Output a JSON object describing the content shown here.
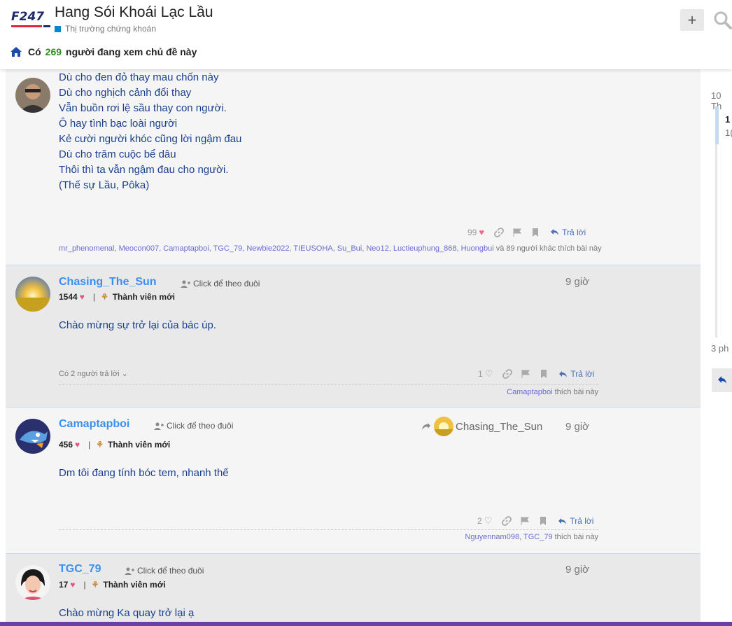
{
  "header": {
    "logo_text": "F247",
    "title": "Hang Sói Khoái Lạc Lầu",
    "category": "Thị trường chứng khoán",
    "plus_label": "+",
    "viewers_prefix": "Có",
    "viewers_count": "269",
    "viewers_suffix": "người đang xem chủ đề này"
  },
  "posts": [
    {
      "body": "Dù cho đen đỏ thay mau chốn này\nDù cho nghịch cảnh đổi thay\nVẫn buồn rơi lệ sầu thay con người.\nÔ hay tình bạc loài người\nKẻ cười người khóc cũng lời ngậm đau\nDù cho trăm cuộc bể dâu\nThôi thì ta vẫn ngậm đau cho người.\n(Thế sự Lầu, Pôka)",
      "like_count": "99",
      "reply_label": "Trả lời",
      "likers": [
        "mr_phenomenal",
        "Meocon007",
        "Camaptapboi",
        "TGC_79",
        "Newbie2022",
        "TIEUSOHA",
        "Su_Bui",
        "Neo12",
        "Luctieuphung_868",
        "Huongbui"
      ],
      "likers_suffix": "và 89 người khác thích bài này"
    },
    {
      "username": "Chasing_The_Sun",
      "follow": "Click để theo đuôi",
      "time": "9 giờ",
      "hearts": "1544",
      "rank": "Thành viên mới",
      "body": "Chào mừng sự trở lại của bác úp.",
      "replies_toggle": "Có 2 người trả lời",
      "like_count": "1",
      "reply_label": "Trả lời",
      "likers": [
        "Camaptapboi"
      ],
      "likers_suffix": "thích bài này"
    },
    {
      "username": "Camaptapboi",
      "follow": "Click để theo đuôi",
      "reply_to": "Chasing_The_Sun",
      "time": "9 giờ",
      "hearts": "456",
      "rank": "Thành viên mới",
      "body": "Dm tôi đang tính bóc tem, nhanh thế",
      "like_count": "2",
      "reply_label": "Trả lời",
      "likers": [
        "Nguyennam098",
        "TGC_79"
      ],
      "likers_suffix": "thích bài này"
    },
    {
      "username": "TGC_79",
      "follow": "Click để theo đuôi",
      "time": "9 giờ",
      "hearts": "17",
      "rank": "Thành viên mới",
      "body": "Chào mừng Ka quay trở lại ạ"
    }
  ],
  "timeline": {
    "top_label": "10 Th",
    "current_a": "1",
    "current_b": "1(",
    "bottom_label": "3 ph"
  },
  "colors": {
    "accent_blue": "#3b8ff0",
    "heart": "#e8537a",
    "viewer_count": "#2e8b1f",
    "bottom_bar": "#6a3fa8"
  }
}
